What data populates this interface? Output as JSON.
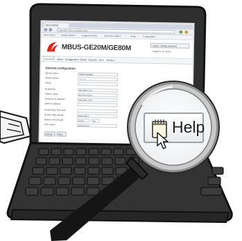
{
  "browser": {
    "tab_label": "MBus-GE80M",
    "url": "http://192.168.1.127/index.html",
    "bookmarks": [
      "Most Visited",
      "Getting Started",
      "Suggested Sites",
      "Web Slice Gallery",
      "Relay",
      "Configuration"
    ]
  },
  "device": {
    "title": "MBUS-GE20M/GE80M",
    "logout_label": "Logout",
    "change_password_label": "Change password",
    "logged_in_as": "Logged in as: admin"
  },
  "menu": {
    "items": [
      "General",
      "Meter",
      "Configuration",
      "Server",
      "Security",
      "User",
      "Service"
    ],
    "active_index": 0
  },
  "section": {
    "title": "General configuration"
  },
  "fields": [
    {
      "label": "Device name",
      "value": "MBUS-GE80M",
      "dim": false
    },
    {
      "label": "Serial number",
      "value": "123456",
      "dim": true
    },
    {
      "label": "Install.",
      "value": "",
      "dim": false
    },
    {
      "label": "IP address",
      "value": "192.168.1.127",
      "dim": false
    },
    {
      "label": "Subnet mask",
      "value": "255.255.255.0",
      "dim": false
    },
    {
      "label": "Gateway IP address",
      "value": "192.168.1.254",
      "dim": false
    },
    {
      "label": "DNS-IP address",
      "value": "",
      "dim": false
    },
    {
      "label": "Preliminary Time shift",
      "value": "",
      "dim": false
    },
    {
      "label": "System date (local)",
      "value": "28.04.2017",
      "dim": false
    },
    {
      "label": "System time (local)",
      "value": "14:35",
      "dim": false
    },
    {
      "label": "NTP server",
      "value": "pool.ntp.org",
      "dim": false
    }
  ],
  "time_extra": "20",
  "buttons": {
    "refresh": "Refresh",
    "save": "Save"
  },
  "help": {
    "label": "Help"
  },
  "colors": {
    "laptop_body": "#2f2f2f",
    "laptop_outline": "#111111",
    "key": "#3a3a3a",
    "lens_rim": "#b5b5b5",
    "handle": "#111111",
    "logo_red": "#e1251b"
  },
  "icons": {
    "logo": "brand-swoosh-logo",
    "notepad": "notepad-icon",
    "cursor": "pointer-cursor-icon",
    "magnifier": "magnifying-glass-icon",
    "laptop": "laptop-icon"
  }
}
